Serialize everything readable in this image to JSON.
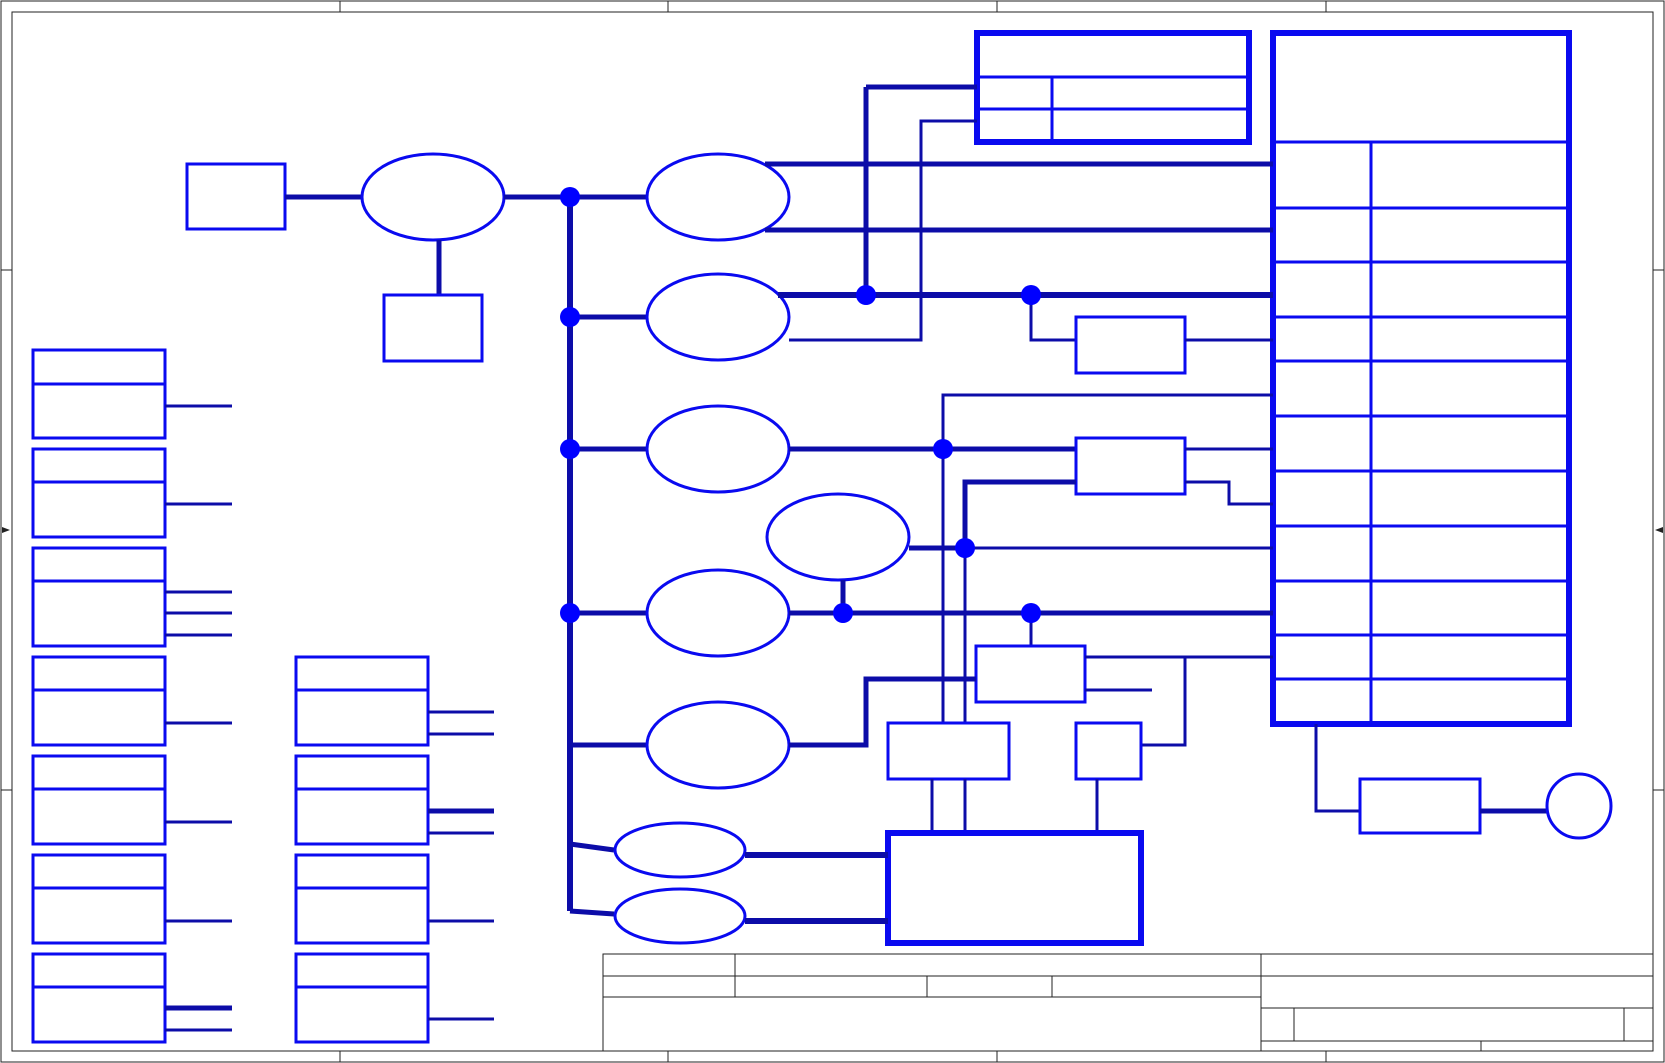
{
  "colors": {
    "outline": "#0a0af0",
    "bus": "#0c0ca8",
    "junction": "#0000ff",
    "frame": "#222222",
    "background": "#ffffff"
  },
  "icons": {
    "junction": "filled-circle",
    "border_arrow": "arrowhead"
  },
  "texts": {}
}
